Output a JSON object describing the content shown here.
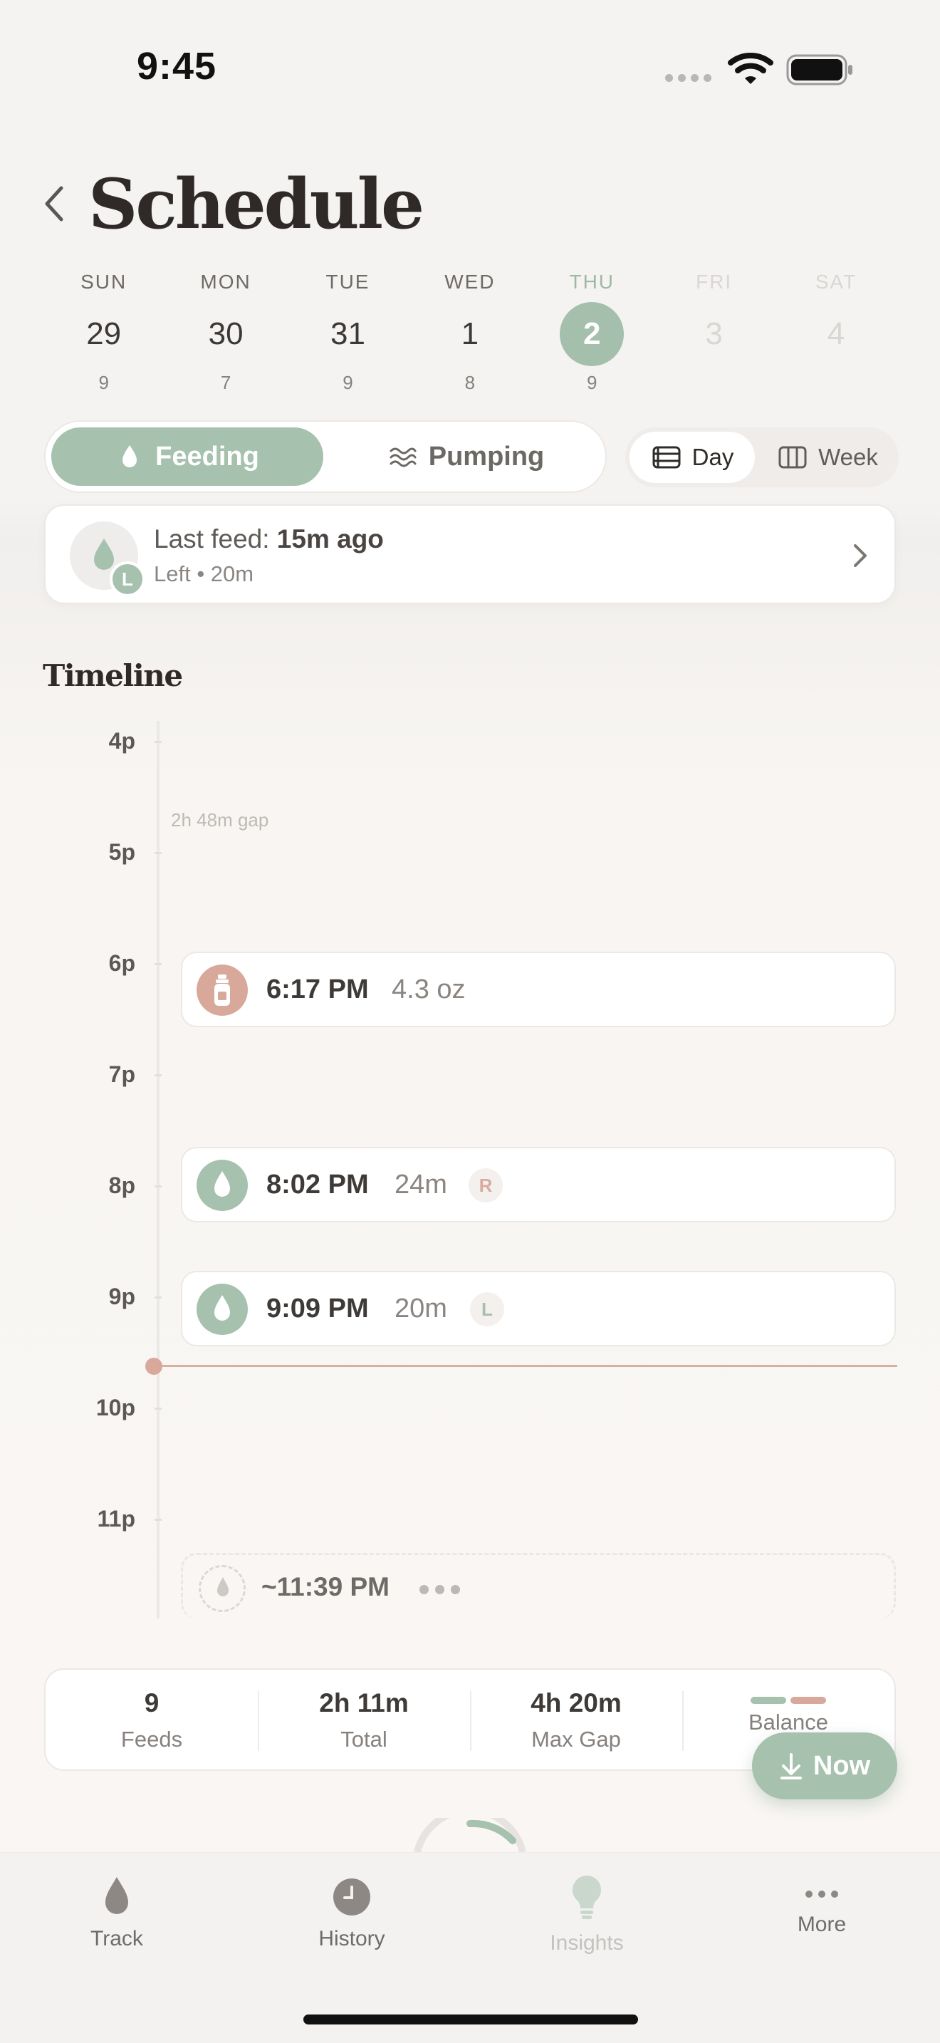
{
  "status_bar": {
    "time": "9:45"
  },
  "header": {
    "title": "Schedule"
  },
  "week": [
    {
      "name": "SUN",
      "num": "29",
      "count": "9",
      "state": "past"
    },
    {
      "name": "MON",
      "num": "30",
      "count": "7",
      "state": "past"
    },
    {
      "name": "TUE",
      "num": "31",
      "count": "9",
      "state": "past"
    },
    {
      "name": "WED",
      "num": "1",
      "count": "8",
      "state": "past"
    },
    {
      "name": "THU",
      "num": "2",
      "count": "9",
      "state": "selected"
    },
    {
      "name": "FRI",
      "num": "3",
      "count": "",
      "state": "future"
    },
    {
      "name": "SAT",
      "num": "4",
      "count": "",
      "state": "future"
    }
  ],
  "mode_toggle": {
    "feeding": "Feeding",
    "pumping": "Pumping"
  },
  "view_toggle": {
    "day": "Day",
    "week": "Week"
  },
  "last_feed": {
    "label": "Last feed:",
    "ago": "15m ago",
    "side_badge": "L",
    "detail": "Left • 20m"
  },
  "timeline": {
    "title": "Timeline",
    "hours": [
      "4p",
      "5p",
      "6p",
      "7p",
      "8p",
      "9p",
      "10p",
      "11p"
    ],
    "gap_label": "2h 48m gap",
    "events": [
      {
        "type": "bottle",
        "time": "6:17 PM",
        "detail": "4.3 oz",
        "side": ""
      },
      {
        "type": "breast",
        "time": "8:02 PM",
        "detail": "24m",
        "side": "R"
      },
      {
        "type": "breast",
        "time": "9:09 PM",
        "detail": "20m",
        "side": "L"
      }
    ],
    "predicted": {
      "time": "~11:39 PM"
    }
  },
  "stats": [
    {
      "value": "9",
      "label": "Feeds"
    },
    {
      "value": "2h 11m",
      "label": "Total"
    },
    {
      "value": "4h 20m",
      "label": "Max Gap"
    },
    {
      "value": "",
      "label": "Balance"
    }
  ],
  "now_button": {
    "label": "Now"
  },
  "tabs": [
    {
      "label": "Track",
      "icon": "drop-icon"
    },
    {
      "label": "History",
      "icon": "clock-icon"
    },
    {
      "label": "Insights",
      "icon": "lightbulb-icon"
    },
    {
      "label": "More",
      "icon": "more-dots-icon"
    }
  ],
  "colors": {
    "accent_green": "#a6c1ad",
    "bottle_rose": "#d8a99b",
    "now_line": "#d8b0a3",
    "background": "#f7f4f1"
  }
}
